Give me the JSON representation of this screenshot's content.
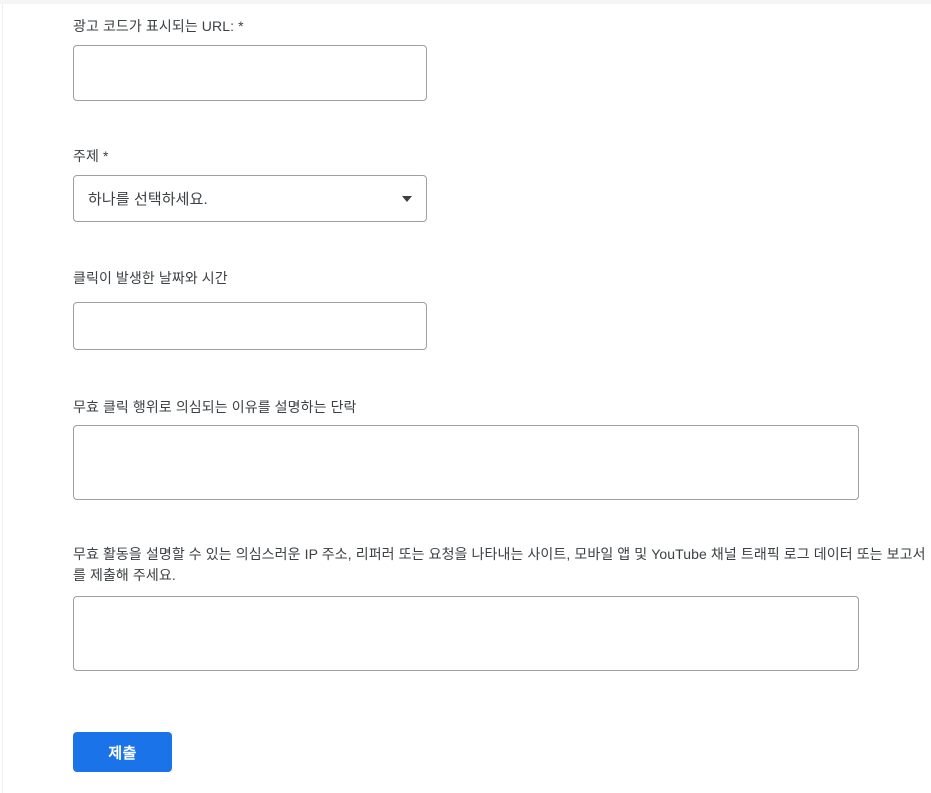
{
  "form": {
    "fields": [
      {
        "label": "광고 코드가 표시되는 URL: *",
        "type": "text",
        "value": "",
        "placeholder": ""
      },
      {
        "label": "주제 *",
        "type": "select",
        "selected": "하나를 선택하세요.",
        "caret_icon": "chevron-down-icon"
      },
      {
        "label": "클릭이 발생한 날짜와 시간",
        "type": "text",
        "value": "",
        "placeholder": ""
      },
      {
        "label": "무효 클릭 행위로 의심되는 이유를 설명하는 단락",
        "type": "textarea",
        "value": "",
        "placeholder": ""
      },
      {
        "label": "무효 활동을 설명할 수 있는 의심스러운 IP 주소, 리퍼러 또는 요청을 나타내는 사이트, 모바일 앱 및 YouTube 채널 트래픽 로그 데이터 또는 보고서를 제출해 주세요.",
        "type": "textarea",
        "value": "",
        "placeholder": ""
      }
    ],
    "submit_label": "제출"
  },
  "colors": {
    "accent": "#1a73e8",
    "border": "#9aa0a6",
    "label_text": "#3c4043",
    "page_background": "#ffffff"
  }
}
